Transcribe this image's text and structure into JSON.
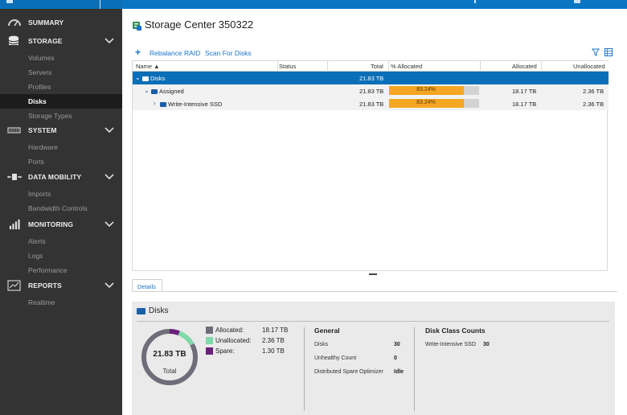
{
  "sidebar": {
    "groups": [
      {
        "label": "SUMMARY",
        "icon": "speedometer-icon"
      },
      {
        "label": "STORAGE",
        "icon": "database-icon",
        "items": [
          "Volumes",
          "Servers",
          "Profiles",
          "Disks",
          "Storage Types"
        ]
      },
      {
        "label": "SYSTEM",
        "icon": "hardware-icon",
        "items": [
          "Hardware",
          "Ports"
        ]
      },
      {
        "label": "DATA MOBILITY",
        "icon": "data-mobility-icon",
        "items": [
          "Imports",
          "Bandwidth Controls"
        ]
      },
      {
        "label": "MONITORING",
        "icon": "monitoring-icon",
        "items": [
          "Alerts",
          "Logs",
          "Performance"
        ]
      },
      {
        "label": "REPORTS",
        "icon": "reports-icon",
        "items": [
          "Realtime"
        ]
      }
    ],
    "active_item": "Disks"
  },
  "header": {
    "title": "Storage Center 350322"
  },
  "toolbar": {
    "rebalance_label": "Rebalance RAID",
    "scan_label": "Scan For Disks"
  },
  "table": {
    "columns": [
      "Name ▲",
      "Status",
      "Total",
      "% Allocated",
      "Allocated",
      "Unallocated"
    ],
    "rows": [
      {
        "name": "Disks",
        "status": "",
        "total": "21.83 TB",
        "pct": "",
        "allocated": "",
        "unallocated": "",
        "level": 0,
        "selected": true
      },
      {
        "name": "Assigned",
        "status": "",
        "total": "21.83 TB",
        "pct": "83.24%",
        "allocated": "18.17 TB",
        "unallocated": "2.36 TB",
        "level": 1,
        "selected": false
      },
      {
        "name": "Write-Intensive SSD",
        "status": "",
        "total": "21.83 TB",
        "pct": "83.24%",
        "allocated": "18.17 TB",
        "unallocated": "2.36 TB",
        "level": 2,
        "selected": false
      }
    ],
    "pct_allocated_value": 83.24
  },
  "details": {
    "tab_label": "Details",
    "panel_title": "Disks",
    "donut": {
      "total_label": "21.83 TB",
      "sub_label": "Total"
    },
    "legend": [
      {
        "name": "Allocated:",
        "value": "18.17 TB",
        "color": "#6e6e7a",
        "tb": 18.17
      },
      {
        "name": "Unallocated:",
        "value": "2.36 TB",
        "color": "#7fd9a8",
        "tb": 2.36
      },
      {
        "name": "Spare:",
        "value": "1.30 TB",
        "color": "#6a1f7a",
        "tb": 1.3
      }
    ],
    "general": {
      "heading": "General",
      "rows": [
        {
          "k": "Disks",
          "v": "30"
        },
        {
          "k": "Unhealthy Count",
          "v": "0"
        },
        {
          "k": "Distributed Spare Optimizer",
          "v": "Idle"
        }
      ]
    },
    "disk_class": {
      "heading": "Disk Class Counts",
      "rows": [
        {
          "k": "Write-Intensive SSD",
          "v": "30"
        }
      ]
    }
  },
  "colors": {
    "accent": "#0a6fb7",
    "link": "#1a73c8",
    "bar_fill": "#f5a623",
    "sidebar_bg": "#333333"
  }
}
